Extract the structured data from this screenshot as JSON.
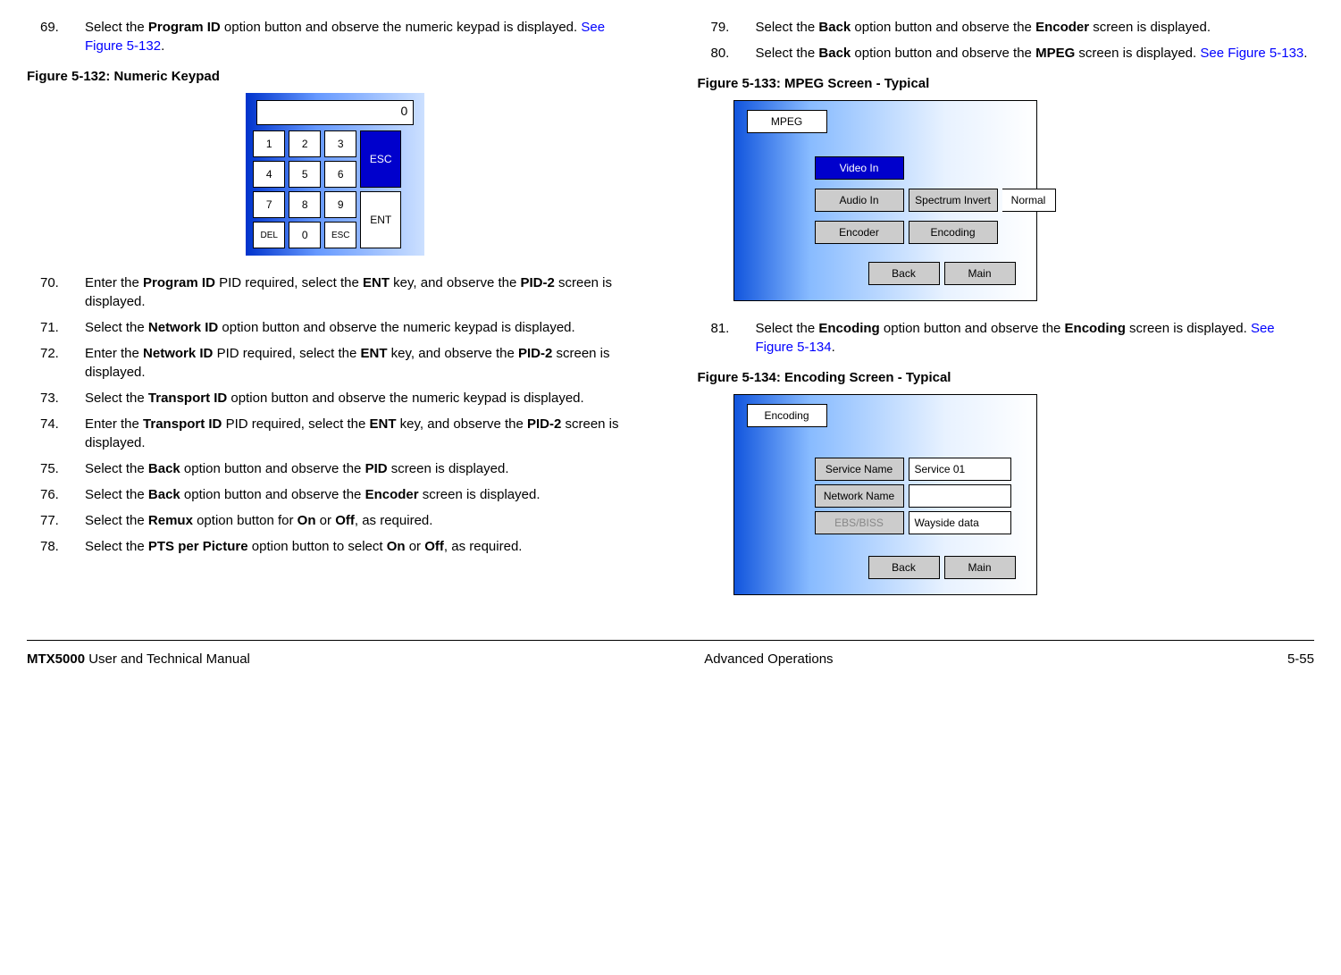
{
  "left": {
    "steps": [
      {
        "n": "69.",
        "pre": "Select the ",
        "b1": "Program ID",
        "mid": " option button and observe the numeric keypad is displayed.  ",
        "link": "See Figure 5-132",
        "post": "."
      },
      {
        "n": "70.",
        "pre": "Enter the ",
        "b1": "Program ID",
        "mid": " PID required, select the ",
        "b2": "ENT",
        "mid2": " key, and observe the ",
        "b3": "PID-2",
        "post": " screen is displayed."
      },
      {
        "n": "71.",
        "pre": "Select the ",
        "b1": "Network ID",
        "post": " option button and observe the numeric keypad is displayed."
      },
      {
        "n": "72.",
        "pre": "Enter the ",
        "b1": "Network ID",
        "mid": " PID required, select the ",
        "b2": "ENT",
        "mid2": " key, and observe the ",
        "b3": "PID-2",
        "post": " screen is displayed."
      },
      {
        "n": "73.",
        "pre": "Select the ",
        "b1": "Transport ID",
        "post": " option button and observe the numeric keypad is displayed."
      },
      {
        "n": "74.",
        "pre": "Enter the ",
        "b1": "Transport ID",
        "mid": " PID required, select the ",
        "b2": "ENT",
        "mid2": " key, and observe the ",
        "b3": "PID-2",
        "post": " screen is displayed."
      },
      {
        "n": "75.",
        "pre": "Select the ",
        "b1": "Back",
        "mid": " option button and observe the ",
        "b2": "PID",
        "post": " screen is displayed."
      },
      {
        "n": "76.",
        "pre": "Select the ",
        "b1": "Back",
        "mid": " option button and observe the ",
        "b2": "Encoder",
        "post": " screen is displayed."
      },
      {
        "n": "77.",
        "pre": "Select the ",
        "b1": "Remux",
        "mid": " option button for ",
        "b2": "On",
        "mid2": " or ",
        "b3": "Off",
        "post": ", as required."
      },
      {
        "n": "78.",
        "pre": "Select the ",
        "b1": "PTS per Picture",
        "mid": " option button to select ",
        "b2": "On",
        "mid2": " or ",
        "b3": "Off",
        "post": ", as required."
      }
    ],
    "fig132cap": "Figure 5-132:   Numeric Keypad",
    "keypad": {
      "display": "0",
      "keys": [
        "1",
        "2",
        "3",
        "4",
        "5",
        "6",
        "7",
        "8",
        "9",
        "DEL",
        "0",
        "ESC"
      ],
      "esc": "ESC",
      "ent": "ENT"
    }
  },
  "right": {
    "steps_top": [
      {
        "n": "79.",
        "pre": "Select the ",
        "b1": "Back",
        "mid": " option button and observe the ",
        "b2": "Encoder",
        "post": " screen is displayed."
      },
      {
        "n": "80.",
        "pre": "Select the ",
        "b1": "Back",
        "mid": " option button and observe the ",
        "b2": "MPEG",
        "mid2": " screen is displayed.  ",
        "link": "See Figure 5-133",
        "post": "."
      }
    ],
    "fig133cap": "Figure 5-133:   MPEG Screen - Typical",
    "mpeg": {
      "tab": "MPEG",
      "video": "Video In",
      "audio": "Audio In",
      "spectrum": "Spectrum Invert",
      "normal": "Normal",
      "encoder": "Encoder",
      "encoding": "Encoding",
      "back": "Back",
      "main": "Main"
    },
    "step81": {
      "n": "81.",
      "pre": "Select the ",
      "b1": "Encoding",
      "mid": " option button and observe the ",
      "b2": "Encoding",
      "mid2": " screen is displayed.  ",
      "link": "See Figure 5-134",
      "post": "."
    },
    "fig134cap": "Figure 5-134:   Encoding Screen - Typical",
    "encoding": {
      "tab": "Encoding",
      "servicename": "Service Name",
      "service01": "Service 01",
      "networkname": "Network Name",
      "ebs": "EBS/BISS",
      "wayside": "Wayside data",
      "back": "Back",
      "main": "Main"
    }
  },
  "footer": {
    "left_b": "MTX5000",
    "left_t": " User and Technical Manual",
    "center": "Advanced Operations",
    "right": "5-55"
  }
}
